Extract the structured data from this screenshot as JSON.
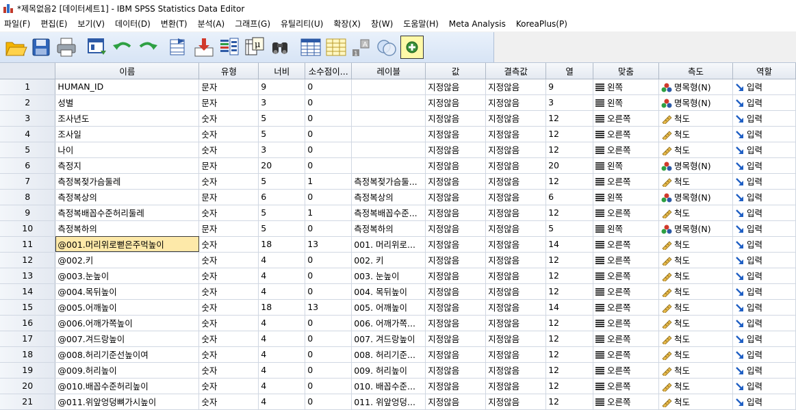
{
  "window": {
    "title": "*제목없음2 [데이터세트1] - IBM SPSS Statistics Data Editor"
  },
  "menu": [
    "파일(F)",
    "편집(E)",
    "보기(V)",
    "데이터(D)",
    "변환(T)",
    "분석(A)",
    "그래프(G)",
    "유틸리티(U)",
    "확장(X)",
    "창(W)",
    "도움말(H)",
    "Meta Analysis",
    "KoreaPlus(P)"
  ],
  "toolbar_icons": [
    "open-icon",
    "save-icon",
    "print-icon",
    "dialog-recall-icon",
    "undo-icon",
    "redo-icon",
    "goto-case-icon",
    "goto-variable-icon",
    "variables-icon",
    "value-labels-icon",
    "find-icon",
    "split-file-icon",
    "select-cases-icon",
    "weight-cases-icon",
    "use-sets-icon",
    "extension-icon"
  ],
  "columns": [
    "이름",
    "유형",
    "너비",
    "소수점이...",
    "레이블",
    "값",
    "결측값",
    "열",
    "맞춤",
    "측도",
    "역할"
  ],
  "rows": [
    [
      "1",
      "HUMAN_ID",
      "문자",
      "9",
      "0",
      "",
      "지정않음",
      "지정않음",
      "9",
      "왼쪽",
      "명목형(N)",
      "입력"
    ],
    [
      "2",
      "성별",
      "문자",
      "3",
      "0",
      "",
      "지정않음",
      "지정않음",
      "3",
      "왼쪽",
      "명목형(N)",
      "입력"
    ],
    [
      "3",
      "조사년도",
      "숫자",
      "5",
      "0",
      "",
      "지정않음",
      "지정않음",
      "12",
      "오른쪽",
      "척도",
      "입력"
    ],
    [
      "4",
      "조사일",
      "숫자",
      "5",
      "0",
      "",
      "지정않음",
      "지정않음",
      "12",
      "오른쪽",
      "척도",
      "입력"
    ],
    [
      "5",
      "나이",
      "숫자",
      "3",
      "0",
      "",
      "지정않음",
      "지정않음",
      "12",
      "오른쪽",
      "척도",
      "입력"
    ],
    [
      "6",
      "측정지",
      "문자",
      "20",
      "0",
      "",
      "지정않음",
      "지정않음",
      "20",
      "왼쪽",
      "명목형(N)",
      "입력"
    ],
    [
      "7",
      "측정복젖가슴둘레",
      "숫자",
      "5",
      "1",
      "측정복젖가슴둘...",
      "지정않음",
      "지정않음",
      "12",
      "오른쪽",
      "척도",
      "입력"
    ],
    [
      "8",
      "측정복상의",
      "문자",
      "6",
      "0",
      "측정복상의",
      "지정않음",
      "지정않음",
      "6",
      "왼쪽",
      "명목형(N)",
      "입력"
    ],
    [
      "9",
      "측정복배꼽수준허리둘레",
      "숫자",
      "5",
      "1",
      "측정복배꼽수준...",
      "지정않음",
      "지정않음",
      "12",
      "오른쪽",
      "척도",
      "입력"
    ],
    [
      "10",
      "측정복하의",
      "문자",
      "5",
      "0",
      "측정복하의",
      "지정않음",
      "지정않음",
      "5",
      "왼쪽",
      "명목형(N)",
      "입력"
    ],
    [
      "11",
      "@001.머리위로뻗은주먹높이",
      "숫자",
      "18",
      "13",
      "001. 머리위로...",
      "지정않음",
      "지정않음",
      "14",
      "오른쪽",
      "척도",
      "입력"
    ],
    [
      "12",
      "@002.키",
      "숫자",
      "4",
      "0",
      "002. 키",
      "지정않음",
      "지정않음",
      "12",
      "오른쪽",
      "척도",
      "입력"
    ],
    [
      "13",
      "@003.눈높이",
      "숫자",
      "4",
      "0",
      "003. 눈높이",
      "지정않음",
      "지정않음",
      "12",
      "오른쪽",
      "척도",
      "입력"
    ],
    [
      "14",
      "@004.목뒤높이",
      "숫자",
      "4",
      "0",
      "004. 목뒤높이",
      "지정않음",
      "지정않음",
      "12",
      "오른쪽",
      "척도",
      "입력"
    ],
    [
      "15",
      "@005.어깨높이",
      "숫자",
      "18",
      "13",
      "005. 어깨높이",
      "지정않음",
      "지정않음",
      "14",
      "오른쪽",
      "척도",
      "입력"
    ],
    [
      "16",
      "@006.어깨가쪽높이",
      "숫자",
      "4",
      "0",
      "006. 어깨가쪽...",
      "지정않음",
      "지정않음",
      "12",
      "오른쪽",
      "척도",
      "입력"
    ],
    [
      "17",
      "@007.겨드랑높이",
      "숫자",
      "4",
      "0",
      "007. 겨드랑높이",
      "지정않음",
      "지정않음",
      "12",
      "오른쪽",
      "척도",
      "입력"
    ],
    [
      "18",
      "@008.허리기준선높이여",
      "숫자",
      "4",
      "0",
      "008. 허리기준...",
      "지정않음",
      "지정않음",
      "12",
      "오른쪽",
      "척도",
      "입력"
    ],
    [
      "19",
      "@009.허리높이",
      "숫자",
      "4",
      "0",
      "009. 허리높이",
      "지정않음",
      "지정않음",
      "12",
      "오른쪽",
      "척도",
      "입력"
    ],
    [
      "20",
      "@010.배꼽수준허리높이",
      "숫자",
      "4",
      "0",
      "010. 배꼽수준...",
      "지정않음",
      "지정않음",
      "12",
      "오른쪽",
      "척도",
      "입력"
    ],
    [
      "21",
      "@011.위앞엉덩뼈가시높이",
      "숫자",
      "4",
      "0",
      "011. 위앞엉덩...",
      "지정않음",
      "지정않음",
      "12",
      "오른쪽",
      "척도",
      "입력"
    ]
  ],
  "selected_cell": {
    "row": 11,
    "column": "이름"
  }
}
